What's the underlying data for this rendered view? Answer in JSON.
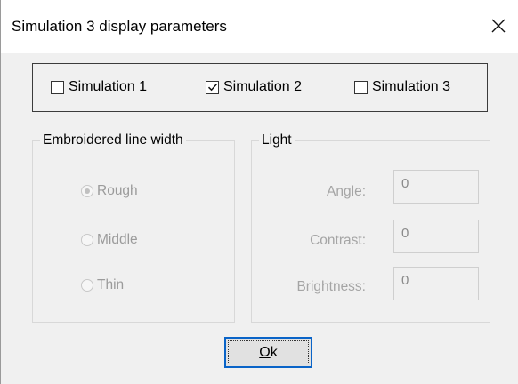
{
  "dialog": {
    "title": "Simulation 3 display parameters",
    "close_glyph": "✕"
  },
  "simulations": [
    {
      "label": "Simulation 1",
      "checked": false
    },
    {
      "label": "Simulation 2",
      "checked": true
    },
    {
      "label": "Simulation 3",
      "checked": false
    }
  ],
  "line_width": {
    "title": "Embroidered line width",
    "options": [
      {
        "label": "Rough",
        "selected": true
      },
      {
        "label": "Middle",
        "selected": false
      },
      {
        "label": "Thin",
        "selected": false
      }
    ]
  },
  "light": {
    "title": "Light",
    "fields": [
      {
        "label": "Angle:",
        "value": "0"
      },
      {
        "label": "Contrast:",
        "value": "0"
      },
      {
        "label": "Brightness:",
        "value": "0"
      }
    ]
  },
  "ok_button": {
    "mnemonic": "O",
    "rest": "k"
  },
  "colors": {
    "focus_border": "#0a64c8",
    "disabled_text": "#9b9b9b",
    "dialog_bg": "#f0f0f0"
  },
  "icons": {
    "close": "close-icon",
    "check": "checkmark-icon"
  }
}
